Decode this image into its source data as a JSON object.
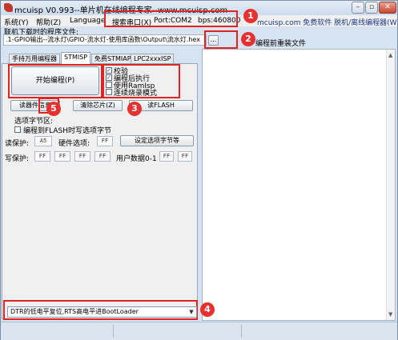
{
  "window": {
    "title": "mcuisp V0.993--单片机在线编程专家--www.mcuisp.com"
  },
  "menu": {
    "items": [
      "系统(Y)",
      "帮助(Z)",
      "Language",
      "搜索串口(X)",
      "Port:COM2",
      "bps:460800"
    ],
    "right_text": "mcuisp.com 免费软件 脱机/离线编程器(W)"
  },
  "program_file": {
    "label": "联机下载时的程序文件:",
    "path": ".1-GPIO输出--流水灯\\GPIO-流水灯-使用库函数\\Output\\流水灯.hex",
    "browse_label": "...",
    "reload_label": "编程前重装文件"
  },
  "tabs": [
    "手持万用编程器",
    "STMISP",
    "免费STMIAP",
    "LPC2xxxISP"
  ],
  "stmisp": {
    "start_label": "开始编程(P)",
    "options": [
      {
        "label": "校验",
        "checked": true
      },
      {
        "label": "编程后执行",
        "checked": true
      },
      {
        "label": "使用RamIsp",
        "checked": false
      },
      {
        "label": "连续烧录模式",
        "checked": false
      }
    ],
    "read_info_label": "读器件信息",
    "erase_label": "清除芯片(Z)",
    "read_flash_label": "读FLASH",
    "option_bytes": {
      "title": "选项字节区:",
      "write_flash_option": "编程到FLASH时写选项字节",
      "read_protect_label": "读保护:",
      "read_protect_value": "A5",
      "hw_option_label": "硬件选项:",
      "hw_option_value": "FF",
      "set_button": "设定选项字节等",
      "write_protect_label": "写保护:",
      "write_protect_values": [
        "FF",
        "FF",
        "FF",
        "FF"
      ],
      "user_data_label": "用户数据0-1",
      "user_data_values": [
        "FF",
        "FF"
      ]
    },
    "boot_mode": "DTR的低电平复位,RTS高电平进BootLoader"
  },
  "callouts": [
    "1",
    "2",
    "3",
    "4",
    "5"
  ],
  "colors": {
    "callout": "#e02323",
    "badge": "#e5312f"
  }
}
